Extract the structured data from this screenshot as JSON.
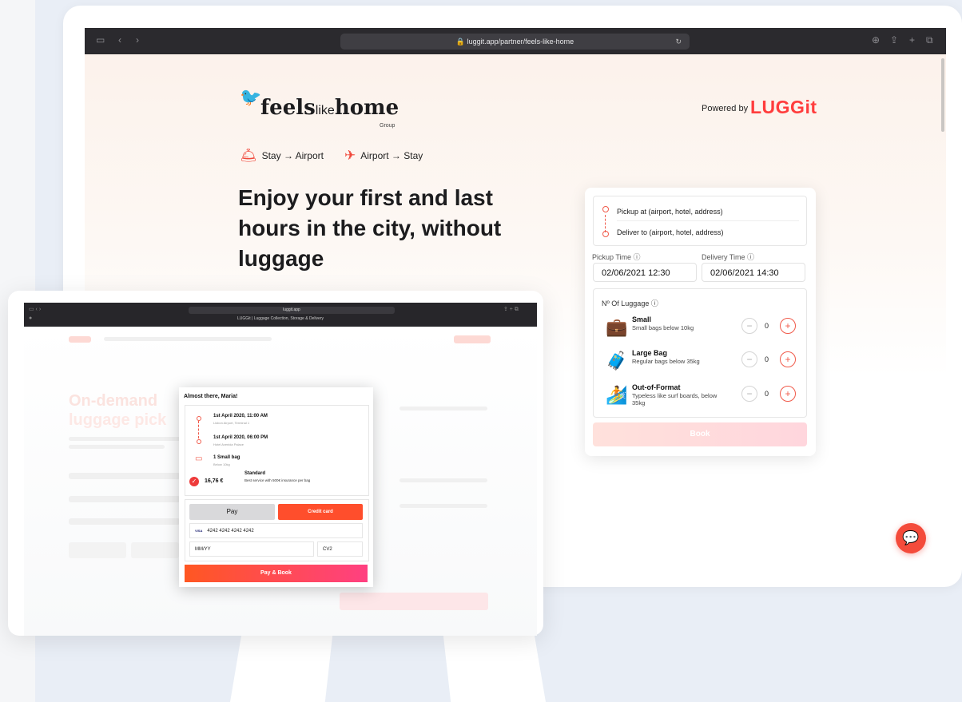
{
  "browser": {
    "url": "luggit.app/partner/feels-like-home"
  },
  "partner": {
    "logo_bold": "feels",
    "logo_light": "like",
    "logo_end": "home",
    "logo_group": "Group",
    "powered_by": "Powered by",
    "brand": "LUGGit"
  },
  "routes": [
    {
      "label": "Stay → Airport"
    },
    {
      "label": "Airport → Stay"
    }
  ],
  "headline": "Enjoy your first and last hours in the city, without luggage",
  "booking": {
    "pickup_placeholder": "Pickup at (airport, hotel, address)",
    "deliver_placeholder": "Deliver to (airport, hotel, address)",
    "pickup_time_label": "Pickup Time",
    "pickup_time": "02/06/2021 12:30",
    "delivery_time_label": "Delivery Time",
    "delivery_time": "02/06/2021 14:30",
    "luggage_label": "Nº Of Luggage",
    "items": [
      {
        "name": "Small",
        "desc": "Small bags below 10kg",
        "count": "0"
      },
      {
        "name": "Large Bag",
        "desc": "Regular bags below 35kg",
        "count": "0"
      },
      {
        "name": "Out-of-Format",
        "desc": "Typeless like surf boards, below 35kg",
        "count": "0"
      }
    ],
    "book_label": "Book"
  },
  "laptop": {
    "url": "luggit.app",
    "tab": "LUGGit | Luggage Collection, Storage & Delivery",
    "bg_heading_1": "On-demand",
    "bg_heading_2": "luggage pick"
  },
  "checkout": {
    "title": "Almost there, Maria!",
    "pickup_date": "1st April 2020, 11:00 AM",
    "pickup_place": "Lisbon Airport, Terminal 1",
    "delivery_date": "1st April 2020, 06:00 PM",
    "delivery_place": "Hotel Avenida Palace",
    "bag": "1 Small bag",
    "bag_sub": "Below 10kg",
    "price": "16,76 €",
    "plan": "Standard",
    "plan_desc": "Best service with 500€ insurance per bag",
    "apple_pay": "Pay",
    "credit_card": "Credit card",
    "card_brand": "VISA",
    "card_number": "4242 4242 4242 4242",
    "expiry_placeholder": "MM/YY",
    "cvv_placeholder": "CV2",
    "pay_button": "Pay & Book"
  }
}
